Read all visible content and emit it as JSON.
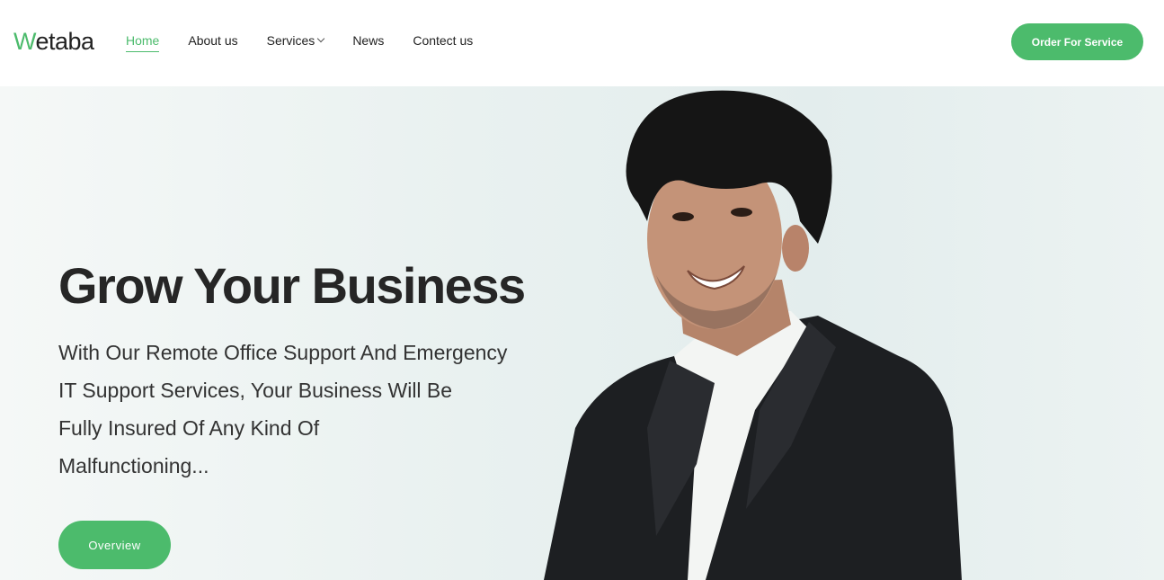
{
  "header": {
    "logo": {
      "first_letter": "W",
      "rest": "etaba"
    },
    "nav": [
      {
        "label": "Home"
      },
      {
        "label": "About us"
      },
      {
        "label": "Services"
      },
      {
        "label": "News"
      },
      {
        "label": "Contect us"
      }
    ],
    "cta_label": "Order For Service"
  },
  "hero": {
    "title": "Grow Your Business",
    "description_lines": [
      "With Our Remote Office Support And Emergency",
      "IT Support Services, Your Business Will Be",
      "Fully Insured Of Any Kind Of",
      "Malfunctioning..."
    ],
    "button_label": "Overview"
  },
  "colors": {
    "accent": "#4cbb6c",
    "text": "#222222"
  }
}
